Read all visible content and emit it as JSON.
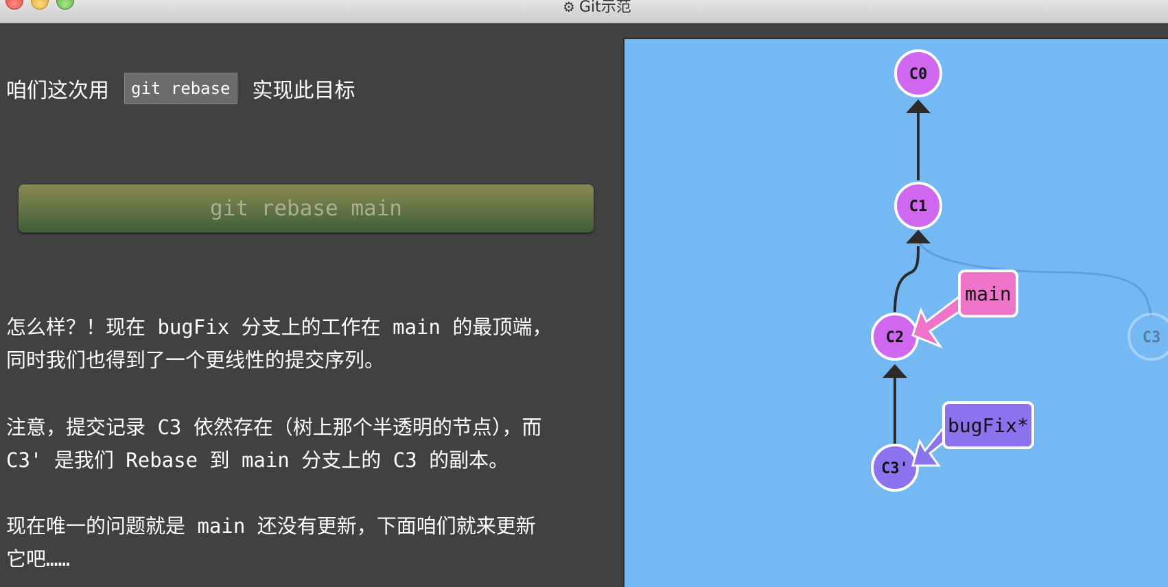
{
  "window": {
    "title": "Git示范",
    "gear_icon": "⚙"
  },
  "instructions": {
    "line1_prefix": "咱们这次用",
    "line1_code": "git rebase",
    "line1_suffix": "实现此目标",
    "command_button": "git rebase main",
    "paragraph1_line1": "怎么样？！现在 bugFix 分支上的工作在 main 的最顶端，",
    "paragraph1_line2": "同时我们也得到了一个更线性的提交序列。",
    "paragraph2_line1": "注意，提交记录 C3 依然存在（树上那个半透明的节点），而",
    "paragraph2_line2": "C3' 是我们 Rebase 到 main 分支上的 C3 的副本。",
    "paragraph3_line1": "现在唯一的问题就是 main 还没有更新，下面咱们就来更新",
    "paragraph3_line2": "它吧……"
  },
  "graph": {
    "background_color": "#74b9f4",
    "commits": [
      {
        "id": "C0",
        "label": "C0",
        "color": "#d068ef"
      },
      {
        "id": "C1",
        "label": "C1",
        "color": "#d068ef"
      },
      {
        "id": "C2",
        "label": "C2",
        "color": "#d068ef"
      },
      {
        "id": "C3",
        "label": "C3",
        "color": "#74b9f4",
        "faded": true
      },
      {
        "id": "C3p",
        "label": "C3'",
        "color": "#8b73f0"
      }
    ],
    "branches": [
      {
        "name": "main",
        "color": "#ef73c8",
        "points_to": "C2"
      },
      {
        "name": "bugFix*",
        "color": "#8b73f0",
        "points_to": "C3'"
      }
    ]
  }
}
